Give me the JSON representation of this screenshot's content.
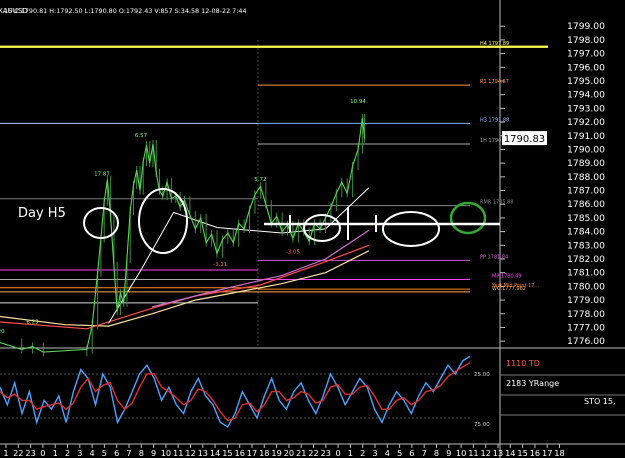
{
  "header": {
    "symbol": "XAUUSD",
    "text": "15  C:1790.81  H:1792.50  L:1790.80  O:1792.43  V:857  S:34.58  12-08-22  7:44"
  },
  "chart_data": {
    "type": "line",
    "title": "",
    "price_axis": {
      "min": 1775.5,
      "max": 1799.6,
      "ticks": [
        1776,
        1777,
        1778,
        1779,
        1780,
        1781,
        1782,
        1783,
        1784,
        1785,
        1786,
        1787,
        1788,
        1789,
        1790,
        1791,
        1792,
        1793,
        1794,
        1795,
        1796,
        1797,
        1798,
        1799
      ],
      "tick_labels": [
        "1776.00",
        "1777.00",
        "1778.00",
        "1779.00",
        "1780.00",
        "1781.00",
        "1782.00",
        "1783.00",
        "1784.00",
        "1785.00",
        "1786.00",
        "1787.00",
        "1788.00",
        "1789.00",
        "1790.00",
        "1791.00",
        "1792.00",
        "1793.00",
        "1794.00",
        "1795.00",
        "1796.00",
        "1797.00",
        "1798.00",
        "1799.00"
      ],
      "current_price_label": "1790.83",
      "current_price": 1790.83
    },
    "time_axis_labels": [
      "1",
      "22",
      "23",
      "0",
      "1",
      "2",
      "3",
      "4",
      "5",
      "6",
      "7",
      "8",
      "9",
      "10",
      "11",
      "12",
      "13",
      "14",
      "15",
      "16",
      "17",
      "18",
      "19",
      "20",
      "21",
      "22",
      "23",
      "0",
      "1",
      "2",
      "3",
      "4",
      "5",
      "6",
      "7",
      "8",
      "9",
      "10",
      "11",
      "12",
      "13",
      "14",
      "15",
      "16",
      "17",
      "18"
    ],
    "price_series": [
      {
        "x": 0,
        "y": 1775.9
      },
      {
        "x": 2,
        "y": 1775.4
      },
      {
        "x": 3,
        "y": 1775.6
      },
      {
        "x": 4,
        "y": 1775.2
      },
      {
        "x": 8,
        "y": 1775.4
      },
      {
        "x": 8.5,
        "y": 1777.2
      },
      {
        "x": 9,
        "y": 1781.0
      },
      {
        "x": 9.3,
        "y": 1783.5
      },
      {
        "x": 9.6,
        "y": 1786.2
      },
      {
        "x": 9.9,
        "y": 1787.8
      },
      {
        "x": 10.2,
        "y": 1785.0
      },
      {
        "x": 10.5,
        "y": 1781.5
      },
      {
        "x": 10.8,
        "y": 1778.2
      },
      {
        "x": 11.1,
        "y": 1779.5
      },
      {
        "x": 11.4,
        "y": 1778.8
      },
      {
        "x": 11.7,
        "y": 1782.0
      },
      {
        "x": 12,
        "y": 1785.5
      },
      {
        "x": 12.3,
        "y": 1787.4
      },
      {
        "x": 12.6,
        "y": 1788.5
      },
      {
        "x": 12.9,
        "y": 1787.0
      },
      {
        "x": 13.2,
        "y": 1789.1
      },
      {
        "x": 13.5,
        "y": 1790.3
      },
      {
        "x": 13.8,
        "y": 1789.0
      },
      {
        "x": 14.1,
        "y": 1790.4
      },
      {
        "x": 14.4,
        "y": 1788.3
      },
      {
        "x": 14.7,
        "y": 1787.0
      },
      {
        "x": 15,
        "y": 1786.6
      },
      {
        "x": 15.4,
        "y": 1787.6
      },
      {
        "x": 15.8,
        "y": 1786.4
      },
      {
        "x": 16.2,
        "y": 1786.6
      },
      {
        "x": 16.6,
        "y": 1785.8
      },
      {
        "x": 17,
        "y": 1786.3
      },
      {
        "x": 17.5,
        "y": 1785.2
      },
      {
        "x": 18,
        "y": 1784.2
      },
      {
        "x": 18.5,
        "y": 1785.0
      },
      {
        "x": 19,
        "y": 1783.2
      },
      {
        "x": 19.5,
        "y": 1783.8
      },
      {
        "x": 20,
        "y": 1782.4
      },
      {
        "x": 20.5,
        "y": 1783.4
      },
      {
        "x": 21,
        "y": 1783.9
      },
      {
        "x": 21.5,
        "y": 1783.2
      },
      {
        "x": 22,
        "y": 1784.6
      },
      {
        "x": 22.5,
        "y": 1784.2
      },
      {
        "x": 23,
        "y": 1785.6
      },
      {
        "x": 23.5,
        "y": 1786.7
      },
      {
        "x": 24,
        "y": 1787.3
      },
      {
        "x": 24.5,
        "y": 1786.0
      },
      {
        "x": 25,
        "y": 1784.6
      },
      {
        "x": 25.5,
        "y": 1785.1
      },
      {
        "x": 26,
        "y": 1784.0
      },
      {
        "x": 26.5,
        "y": 1784.5
      },
      {
        "x": 27,
        "y": 1783.5
      },
      {
        "x": 27.5,
        "y": 1784.6
      },
      {
        "x": 28,
        "y": 1784.0
      },
      {
        "x": 28.5,
        "y": 1783.3
      },
      {
        "x": 29,
        "y": 1784.6
      },
      {
        "x": 29.5,
        "y": 1784.2
      },
      {
        "x": 30,
        "y": 1785.0
      },
      {
        "x": 30.5,
        "y": 1785.8
      },
      {
        "x": 31,
        "y": 1786.8
      },
      {
        "x": 31.5,
        "y": 1787.6
      },
      {
        "x": 32,
        "y": 1786.8
      },
      {
        "x": 32.5,
        "y": 1788.8
      },
      {
        "x": 33,
        "y": 1790.0
      },
      {
        "x": 33.4,
        "y": 1792.3
      },
      {
        "x": 33.6,
        "y": 1790.8
      }
    ],
    "horizontal_levels": [
      {
        "label": "H4 1797.89",
        "value": 1797.5,
        "color": "#ffff55"
      },
      {
        "label": "R1 1794.67",
        "value": 1794.7,
        "color": "#ff9a3c"
      },
      {
        "label": "H3 1791.88",
        "value": 1791.9,
        "color": "#7fb2ff"
      },
      {
        "label": "1H 1790.43",
        "value": 1790.4,
        "color": "#aaaaaa"
      },
      {
        "label": "RMR 1785.88",
        "value": 1785.9,
        "color": "#888888"
      },
      {
        "label": "PP 1781.84",
        "value": 1781.9,
        "color": "#d35bd3"
      },
      {
        "label": "MP 1780.49",
        "value": 1780.5,
        "color": "#ff40ff"
      },
      {
        "label": "Yest Mid Point 17...",
        "value": 1779.8,
        "color": "#ff8c1a"
      },
      {
        "label": "WC:1777.982",
        "value": 1779.6,
        "color": "#ffaa55"
      }
    ],
    "price_labels": [
      {
        "text": "17.87",
        "x": 9.4,
        "y": 1788.1,
        "color": "#7fff7f"
      },
      {
        "text": "6.57",
        "x": 13.0,
        "y": 1790.9,
        "color": "#7fff7f"
      },
      {
        "text": "5.72",
        "x": 24.0,
        "y": 1787.7,
        "color": "#7fff7f"
      },
      {
        "text": "10.94",
        "x": 33.0,
        "y": 1793.4,
        "color": "#7fff7f"
      },
      {
        "text": "6.23",
        "x": 3.0,
        "y": 1777.3,
        "color": "#7fff7f"
      },
      {
        "text": "-3.11",
        "x": 20.3,
        "y": 1781.5,
        "color": "#ff6060"
      },
      {
        "text": "-3.05",
        "x": 27.0,
        "y": 1782.4,
        "color": "#ff6060"
      },
      {
        "text": "20",
        "x": 0.1,
        "y": 1776.6,
        "color": "#7fff7f"
      }
    ],
    "annotations": [
      {
        "text": "Day H5",
        "color": "#ffffff"
      }
    ],
    "oscillator": {
      "name": "STO",
      "labels": [
        "1110 TD",
        "2183 YRange",
        "STO 15,"
      ],
      "levels": [
        "25.00",
        "75.00"
      ],
      "k": [
        60,
        40,
        65,
        30,
        55,
        20,
        45,
        35,
        50,
        20,
        55,
        80,
        70,
        40,
        75,
        60,
        20,
        35,
        55,
        75,
        85,
        70,
        45,
        60,
        40,
        30,
        55,
        70,
        50,
        40,
        20,
        15,
        30,
        55,
        40,
        25,
        50,
        70,
        45,
        35,
        55,
        65,
        45,
        30,
        50,
        75,
        60,
        40,
        55,
        70,
        60,
        35,
        20,
        40,
        55,
        45,
        30,
        50,
        65,
        55,
        70,
        85,
        75,
        90,
        95
      ],
      "d": [
        55,
        48,
        52,
        45,
        45,
        35,
        38,
        40,
        42,
        35,
        42,
        60,
        70,
        55,
        62,
        65,
        45,
        35,
        42,
        60,
        75,
        75,
        60,
        55,
        48,
        40,
        45,
        58,
        55,
        45,
        32,
        22,
        25,
        40,
        42,
        32,
        40,
        55,
        55,
        45,
        48,
        55,
        52,
        42,
        45,
        60,
        63,
        52,
        52,
        60,
        62,
        50,
        35,
        35,
        45,
        48,
        40,
        45,
        55,
        57,
        62,
        72,
        78,
        83,
        88
      ]
    }
  }
}
